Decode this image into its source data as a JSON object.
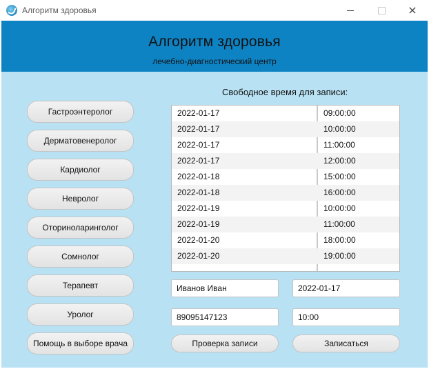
{
  "window": {
    "title": "Алгоритм здоровья",
    "icon": "app-logo-icon",
    "controls": {
      "minimize": "minimize-icon",
      "maximize": "maximize-icon",
      "close": "×"
    }
  },
  "header": {
    "title": "Алгоритм здоровья",
    "subtitle": "лечебно-диагностический центр",
    "background_color": "#0e83c4"
  },
  "content_background_color": "#b8e1f3",
  "doctors": [
    {
      "label": "Гастроэнтеролог"
    },
    {
      "label": "Дерматовенеролог"
    },
    {
      "label": "Кардиолог"
    },
    {
      "label": "Невролог"
    },
    {
      "label": "Оториноларинголог"
    },
    {
      "label": "Сомнолог"
    },
    {
      "label": "Терапевт"
    },
    {
      "label": "Уролог"
    },
    {
      "label": "Помощь в выборе врача"
    }
  ],
  "slots": {
    "label": "Свободное время для записи:",
    "rows": [
      {
        "date": "2022-01-17",
        "time": "09:00:00"
      },
      {
        "date": "2022-01-17",
        "time": "10:00:00"
      },
      {
        "date": "2022-01-17",
        "time": "11:00:00"
      },
      {
        "date": "2022-01-17",
        "time": "12:00:00"
      },
      {
        "date": "2022-01-18",
        "time": "15:00:00"
      },
      {
        "date": "2022-01-18",
        "time": "16:00:00"
      },
      {
        "date": "2022-01-19",
        "time": "10:00:00"
      },
      {
        "date": "2022-01-19",
        "time": "11:00:00"
      },
      {
        "date": "2022-01-20",
        "time": "18:00:00"
      },
      {
        "date": "2022-01-20",
        "time": "19:00:00"
      }
    ]
  },
  "form": {
    "name_value": "Иванов Иван",
    "date_value": "2022-01-17",
    "phone_value": "89095147123",
    "time_value": "10:00",
    "check_button_label": "Проверка записи",
    "book_button_label": "Записаться"
  }
}
